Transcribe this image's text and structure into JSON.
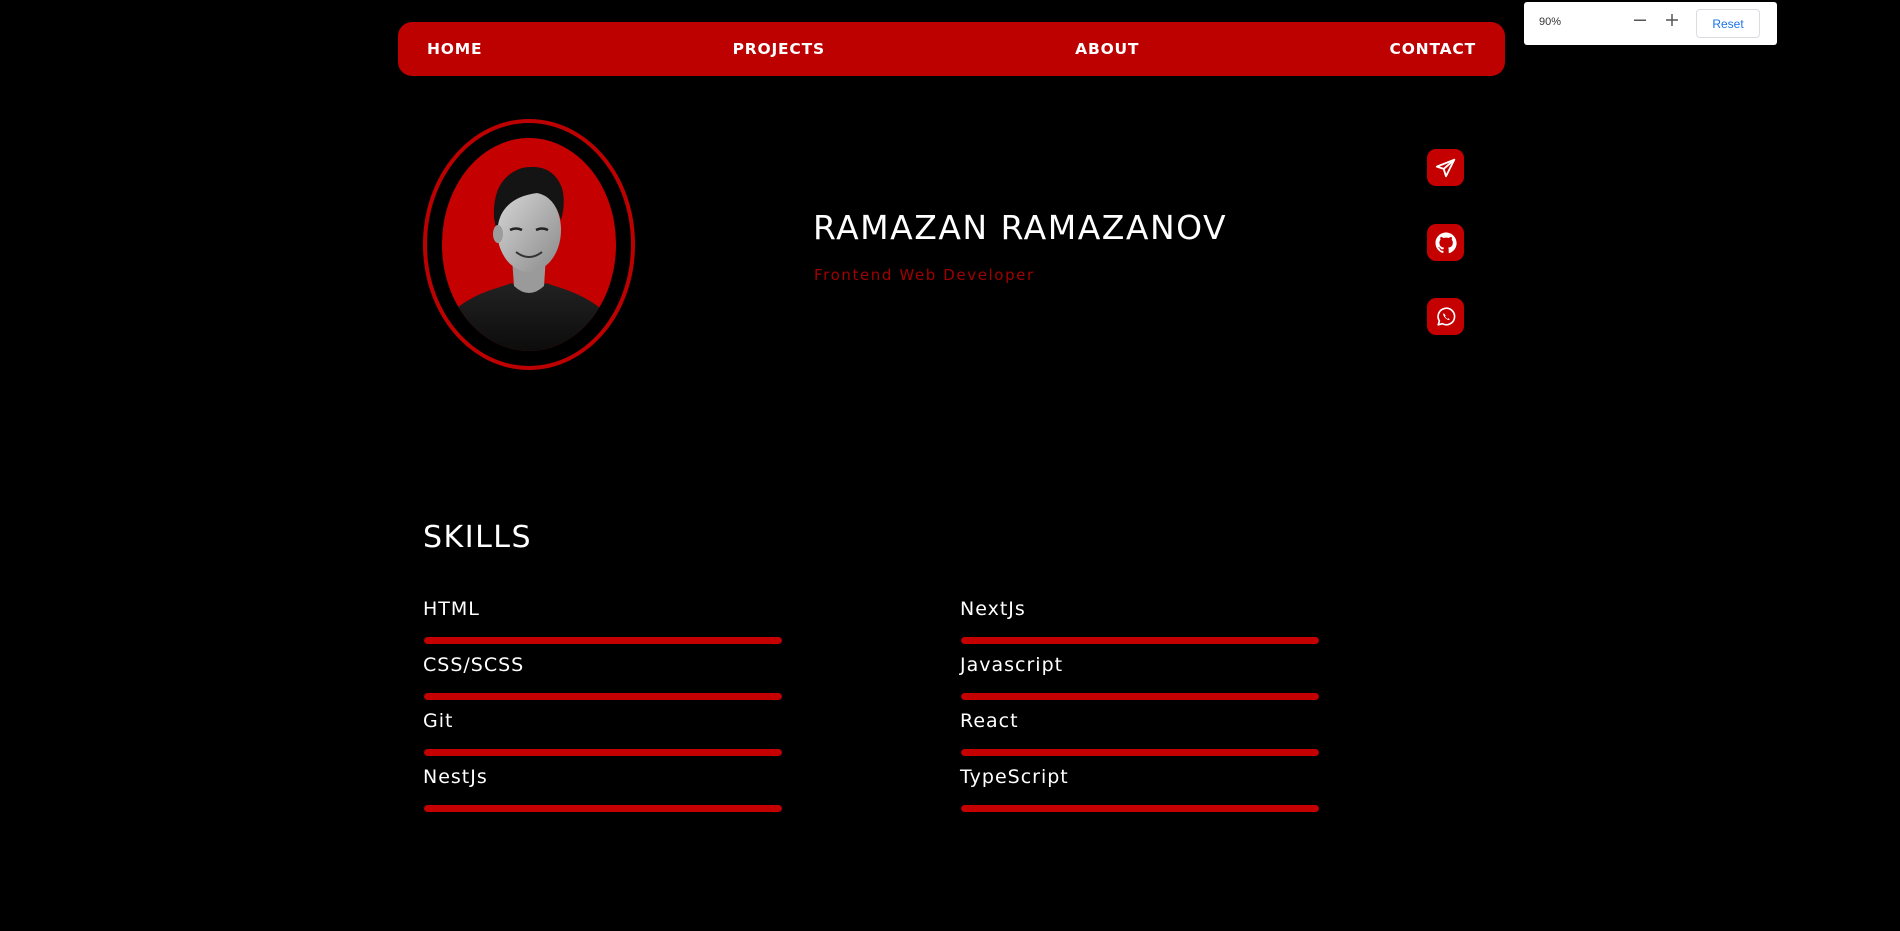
{
  "nav": {
    "links": [
      {
        "label": "HOME"
      },
      {
        "label": "PROJECTS"
      },
      {
        "label": "ABOUT"
      },
      {
        "label": "CONTACT"
      }
    ]
  },
  "zoom": {
    "level": "90%",
    "minus_icon": "minus-icon",
    "plus_icon": "plus-icon",
    "reset_label": "Reset"
  },
  "profile": {
    "name": "RAMAZAN RAMAZANOV",
    "title": "Frontend Web Developer"
  },
  "social": [
    {
      "icon": "telegram-icon"
    },
    {
      "icon": "github-icon"
    },
    {
      "icon": "whatsapp-icon"
    }
  ],
  "skills": {
    "title": "SKILLS",
    "left": [
      {
        "name": "HTML",
        "level": 1.0
      },
      {
        "name": "CSS/SCSS",
        "level": 1.0
      },
      {
        "name": "Git",
        "level": 1.0
      },
      {
        "name": "NestJs",
        "level": 1.0
      }
    ],
    "right": [
      {
        "name": "NextJs",
        "level": 1.0
      },
      {
        "name": "Javascript",
        "level": 1.0
      },
      {
        "name": "React",
        "level": 1.0
      },
      {
        "name": "TypeScript",
        "level": 1.0
      }
    ]
  },
  "colors": {
    "background": "#000000",
    "accent": "#bd0000",
    "subtitle": "#a00000",
    "text": "#ffffff"
  }
}
